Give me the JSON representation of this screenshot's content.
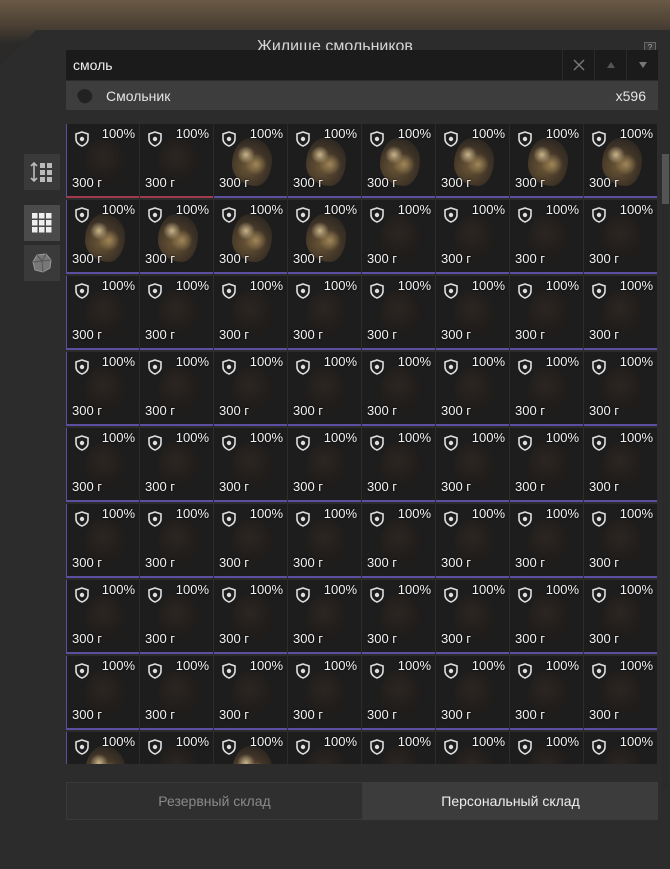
{
  "window": {
    "title": "Жилище смольников",
    "help_label": "?"
  },
  "search": {
    "value": "смоль",
    "clear_icon": "close-icon",
    "up_icon": "arrow-up-icon",
    "down_icon": "arrow-down-icon"
  },
  "suggestion": {
    "name": "Смольник",
    "count": "x596",
    "icon": "resin-icon"
  },
  "sidebar": {
    "buttons": [
      {
        "name": "sort-button",
        "icon": "sort-icon"
      },
      {
        "name": "grid-view-button",
        "icon": "grid-icon",
        "active": true
      },
      {
        "name": "item-filter-button",
        "icon": "ore-icon"
      }
    ]
  },
  "grid": {
    "columns": 8,
    "rows": [
      [
        {
          "pct": "100%",
          "weight": "300 г",
          "look": "dark",
          "edge": "red"
        },
        {
          "pct": "100%",
          "weight": "300 г",
          "look": "dark",
          "edge": "red"
        },
        {
          "pct": "100%",
          "weight": "300 г",
          "look": "bright"
        },
        {
          "pct": "100%",
          "weight": "300 г",
          "look": "bright"
        },
        {
          "pct": "100%",
          "weight": "300 г",
          "look": "bright"
        },
        {
          "pct": "100%",
          "weight": "300 г",
          "look": "bright"
        },
        {
          "pct": "100%",
          "weight": "300 г",
          "look": "bright"
        },
        {
          "pct": "100%",
          "weight": "300 г",
          "look": "bright"
        }
      ],
      [
        {
          "pct": "100%",
          "weight": "300 г",
          "look": "bright"
        },
        {
          "pct": "100%",
          "weight": "300 г",
          "look": "bright"
        },
        {
          "pct": "100%",
          "weight": "300 г",
          "look": "bright"
        },
        {
          "pct": "100%",
          "weight": "300 г",
          "look": "bright"
        },
        {
          "pct": "100%",
          "weight": "300 г",
          "look": "dark"
        },
        {
          "pct": "100%",
          "weight": "300 г",
          "look": "dark"
        },
        {
          "pct": "100%",
          "weight": "300 г",
          "look": "dark"
        },
        {
          "pct": "100%",
          "weight": "300 г",
          "look": "dark"
        }
      ],
      [
        {
          "pct": "100%",
          "weight": "300 г",
          "look": "dark"
        },
        {
          "pct": "100%",
          "weight": "300 г",
          "look": "dark"
        },
        {
          "pct": "100%",
          "weight": "300 г",
          "look": "dark"
        },
        {
          "pct": "100%",
          "weight": "300 г",
          "look": "dark"
        },
        {
          "pct": "100%",
          "weight": "300 г",
          "look": "dark"
        },
        {
          "pct": "100%",
          "weight": "300 г",
          "look": "dark"
        },
        {
          "pct": "100%",
          "weight": "300 г",
          "look": "dark"
        },
        {
          "pct": "100%",
          "weight": "300 г",
          "look": "dark"
        }
      ],
      [
        {
          "pct": "100%",
          "weight": "300 г",
          "look": "dark"
        },
        {
          "pct": "100%",
          "weight": "300 г",
          "look": "dark"
        },
        {
          "pct": "100%",
          "weight": "300 г",
          "look": "dark"
        },
        {
          "pct": "100%",
          "weight": "300 г",
          "look": "dark"
        },
        {
          "pct": "100%",
          "weight": "300 г",
          "look": "dark"
        },
        {
          "pct": "100%",
          "weight": "300 г",
          "look": "dark"
        },
        {
          "pct": "100%",
          "weight": "300 г",
          "look": "dark"
        },
        {
          "pct": "100%",
          "weight": "300 г",
          "look": "dark"
        }
      ],
      [
        {
          "pct": "100%",
          "weight": "300 г",
          "look": "dark"
        },
        {
          "pct": "100%",
          "weight": "300 г",
          "look": "dark"
        },
        {
          "pct": "100%",
          "weight": "300 г",
          "look": "dark"
        },
        {
          "pct": "100%",
          "weight": "300 г",
          "look": "dark"
        },
        {
          "pct": "100%",
          "weight": "300 г",
          "look": "dark"
        },
        {
          "pct": "100%",
          "weight": "300 г",
          "look": "dark"
        },
        {
          "pct": "100%",
          "weight": "300 г",
          "look": "dark"
        },
        {
          "pct": "100%",
          "weight": "300 г",
          "look": "dark"
        }
      ],
      [
        {
          "pct": "100%",
          "weight": "300 г",
          "look": "dark"
        },
        {
          "pct": "100%",
          "weight": "300 г",
          "look": "dark"
        },
        {
          "pct": "100%",
          "weight": "300 г",
          "look": "dark"
        },
        {
          "pct": "100%",
          "weight": "300 г",
          "look": "dark"
        },
        {
          "pct": "100%",
          "weight": "300 г",
          "look": "dark"
        },
        {
          "pct": "100%",
          "weight": "300 г",
          "look": "dark"
        },
        {
          "pct": "100%",
          "weight": "300 г",
          "look": "dark"
        },
        {
          "pct": "100%",
          "weight": "300 г",
          "look": "dark"
        }
      ],
      [
        {
          "pct": "100%",
          "weight": "300 г",
          "look": "dark"
        },
        {
          "pct": "100%",
          "weight": "300 г",
          "look": "dark"
        },
        {
          "pct": "100%",
          "weight": "300 г",
          "look": "dark"
        },
        {
          "pct": "100%",
          "weight": "300 г",
          "look": "dark"
        },
        {
          "pct": "100%",
          "weight": "300 г",
          "look": "dark"
        },
        {
          "pct": "100%",
          "weight": "300 г",
          "look": "dark"
        },
        {
          "pct": "100%",
          "weight": "300 г",
          "look": "dark"
        },
        {
          "pct": "100%",
          "weight": "300 г",
          "look": "dark"
        }
      ],
      [
        {
          "pct": "100%",
          "weight": "300 г",
          "look": "dark"
        },
        {
          "pct": "100%",
          "weight": "300 г",
          "look": "dark"
        },
        {
          "pct": "100%",
          "weight": "300 г",
          "look": "dark"
        },
        {
          "pct": "100%",
          "weight": "300 г",
          "look": "dark"
        },
        {
          "pct": "100%",
          "weight": "300 г",
          "look": "dark"
        },
        {
          "pct": "100%",
          "weight": "300 г",
          "look": "dark"
        },
        {
          "pct": "100%",
          "weight": "300 г",
          "look": "dark"
        },
        {
          "pct": "100%",
          "weight": "300 г",
          "look": "dark"
        }
      ],
      [
        {
          "pct": "100%",
          "weight": "",
          "look": "bright",
          "edge": "green"
        },
        {
          "pct": "100%",
          "weight": "",
          "look": "dark"
        },
        {
          "pct": "100%",
          "weight": "",
          "look": "bright"
        },
        {
          "pct": "100%",
          "weight": "",
          "look": "dark"
        },
        {
          "pct": "100%",
          "weight": "",
          "look": "dark",
          "edge": "green"
        },
        {
          "pct": "100%",
          "weight": "",
          "look": "dark"
        },
        {
          "pct": "100%",
          "weight": "",
          "look": "dark",
          "edge": "green"
        },
        {
          "pct": "100%",
          "weight": "",
          "look": "dark"
        }
      ]
    ]
  },
  "tabs": [
    {
      "label": "Резервный склад",
      "active": false
    },
    {
      "label": "Персональный склад",
      "active": true
    }
  ],
  "colors": {
    "edge_purple": "#5a4fa0",
    "edge_red": "#a03a4c",
    "edge_green": "#3f8f44"
  }
}
